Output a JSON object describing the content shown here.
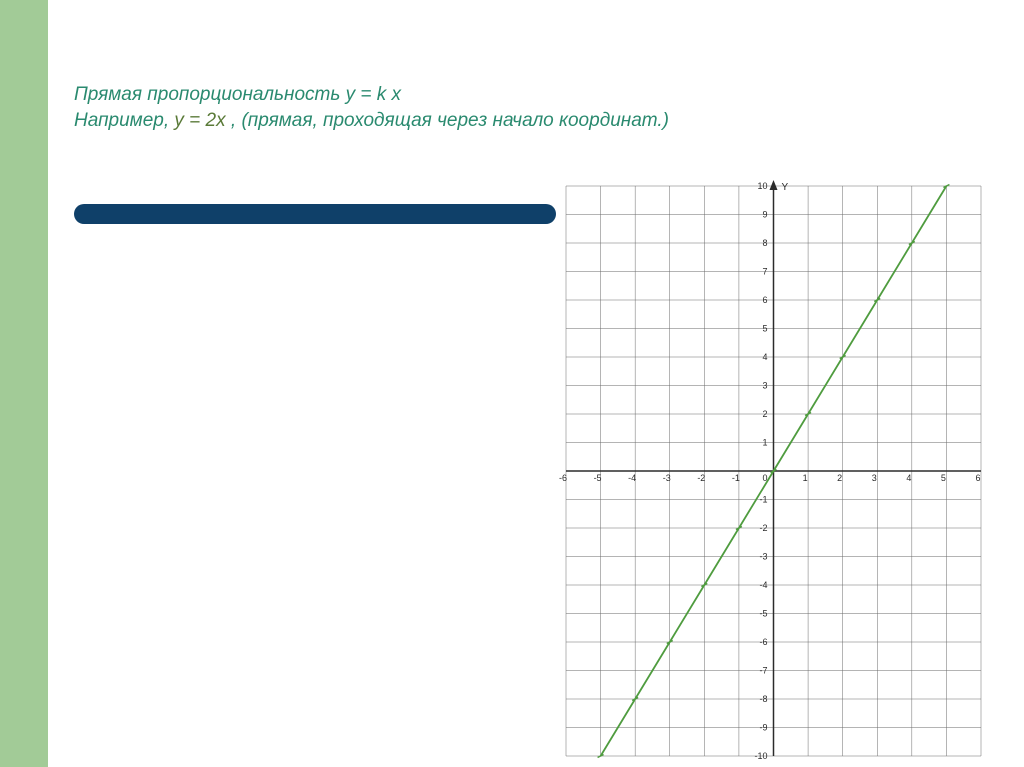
{
  "title": {
    "line1_a": "Прямая пропорциональность    ",
    "line1_b": "у = k х",
    "line2_a": "Например,  ",
    "line2_b": "у = 2х  ",
    "line2_c": ", (прямая, проходящая через начало  координат.)"
  },
  "colors": {
    "sidebar": "#a2cb97",
    "divider": "#0f4069",
    "title_green": "#2a8a6f",
    "function_line": "#4f9c3f",
    "grid": "#6b6b6b",
    "axis": "#2b2b2b"
  },
  "chart_data": {
    "type": "line",
    "title": "",
    "xlabel": "",
    "ylabel": "Y",
    "xlim": [
      -6,
      6
    ],
    "ylim": [
      -10,
      10
    ],
    "xticks": [
      -6,
      -5,
      -4,
      -3,
      -2,
      -1,
      0,
      1,
      2,
      3,
      4,
      5,
      6
    ],
    "yticks": [
      -10,
      -9,
      -8,
      -7,
      -6,
      -5,
      -4,
      -3,
      -2,
      -1,
      0,
      1,
      2,
      3,
      4,
      5,
      6,
      7,
      8,
      9,
      10
    ],
    "series": [
      {
        "name": "y = 2x",
        "x": [
          -5,
          -4,
          -3,
          -2,
          -1,
          0,
          1,
          2,
          3,
          4,
          5
        ],
        "values": [
          -10,
          -8,
          -6,
          -4,
          -2,
          0,
          2,
          4,
          6,
          8,
          10
        ]
      }
    ]
  }
}
